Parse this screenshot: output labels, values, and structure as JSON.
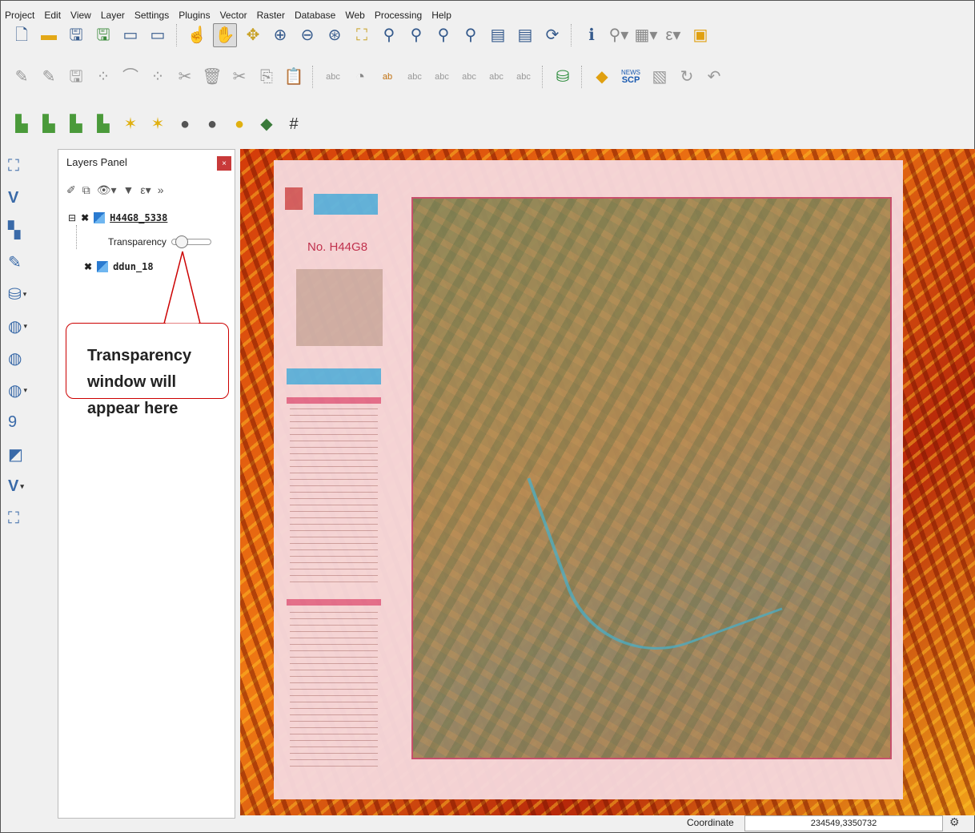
{
  "menu": [
    "Project",
    "Edit",
    "View",
    "Layer",
    "Settings",
    "Plugins",
    "Vector",
    "Raster",
    "Database",
    "Web",
    "Processing",
    "Help"
  ],
  "toolbar1_icons": [
    "new-project-icon",
    "open-icon",
    "save-icon",
    "save-as-icon",
    "new-print-layout-icon",
    "layout-manager-icon",
    "touch-zoom-icon",
    "pan-icon",
    "pan-to-selection-icon",
    "zoom-in-icon",
    "zoom-out-icon",
    "zoom-full-icon",
    "zoom-to-selection-icon",
    "zoom-to-layer-icon",
    "zoom-native-icon",
    "zoom-last-icon",
    "zoom-next-icon",
    "new-bookmark-icon",
    "show-bookmarks-icon",
    "refresh-icon",
    "identify-icon",
    "select-features-icon",
    "select-by-value-icon",
    "deselect-icon",
    "measure-icon"
  ],
  "toolbar2_icons": [
    "current-edits-icon",
    "toggle-editing-icon",
    "save-edits-icon",
    "add-feature-icon",
    "add-circular-string-icon",
    "add-ring-icon",
    "vertex-tool-icon",
    "delete-selected-icon",
    "cut-features-icon",
    "copy-features-icon",
    "paste-features-icon",
    "label-icon",
    "diagram-icon",
    "layer-labeling-icon",
    "pin-labels-icon",
    "show-hide-labels-icon",
    "move-label-icon",
    "rotate-label-icon",
    "change-label-icon",
    "db-manager-icon",
    "python-console-icon",
    "scp-icon",
    "scp-band-icon",
    "scp-undo-icon",
    "scp-redo-icon"
  ],
  "scp_label": {
    "top": "NEWS",
    "bottom": "SCP"
  },
  "toolbar3_icons": [
    "raster-band-1-icon",
    "raster-band-2-icon",
    "raster-band-3-icon",
    "raster-band-4-icon",
    "new-spatialite-icon",
    "new-geopackage-icon",
    "new-temp-layer-icon",
    "new-virtual-layer-icon",
    "add-delimited-text-icon",
    "georeferencer-icon",
    "grid-icon"
  ],
  "side_icons": [
    "add-wms-icon",
    "add-vector-layer-icon",
    "add-raster-layer-icon",
    "add-mesh-layer-icon",
    "add-postgis-layer-icon",
    "add-spatialite-layer-icon",
    "add-wcs-layer-icon",
    "add-wfs-layer-icon",
    "add-delimited-layer-icon",
    "add-virtual-layer-icon",
    "new-shapefile-layer-icon",
    "add-xyz-layer-icon"
  ],
  "layers_panel": {
    "title": "Layers Panel",
    "close": "×",
    "layers": [
      {
        "name": "H44G8_5338",
        "expanded": true
      },
      {
        "name": "ddun_18",
        "expanded": false
      }
    ],
    "transparency_label": "Transparency",
    "transparency_value": 0.1
  },
  "map_sheet": {
    "sheet_no": "No. H44G8"
  },
  "callout": {
    "line1": "Transparency",
    "line2": "window will",
    "line3": "appear here"
  },
  "status": {
    "coordinate_label": "Coordinate",
    "coordinate_value": "234549,3350732"
  },
  "colors": {
    "callout_border": "#cc0000",
    "close_button": "#c83a3a"
  }
}
